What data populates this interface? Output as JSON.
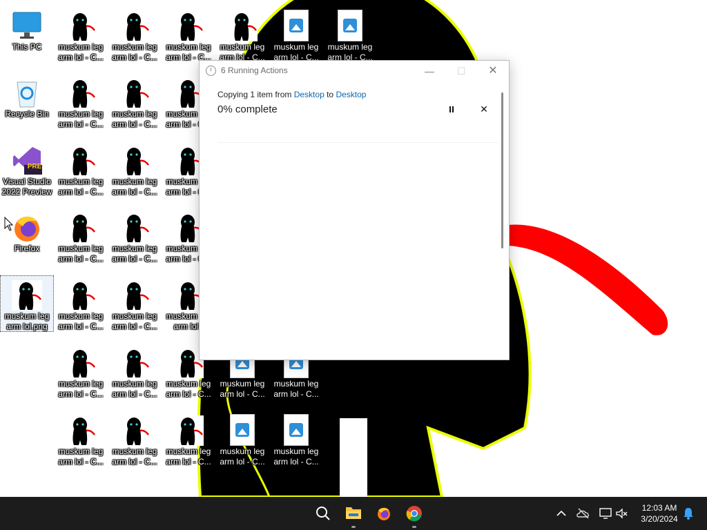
{
  "desktop": {
    "system_icons": [
      {
        "label": "This PC",
        "icon": "monitor-icon"
      },
      {
        "label": "Recycle Bin",
        "icon": "recycle-bin-icon"
      },
      {
        "label": "Visual Studio 2022 Preview",
        "icon": "visual-studio-icon",
        "badge": "PRE"
      },
      {
        "label": "Firefox",
        "icon": "firefox-icon"
      }
    ],
    "file_label_truncated": "muskum leg arm lol - C...",
    "file_label_truncated_short": "muskum leg arm lol - ",
    "file_label_cut": "muskum leg arm lol",
    "file_label_selected": "muskum leg arm lol.png"
  },
  "dialog": {
    "title": "6 Running Actions",
    "copy_prefix": "Copying 1 item from ",
    "source": "Desktop",
    "copy_middle": " to ",
    "destination": "Desktop",
    "progress_text": "0% complete",
    "progress_percent": 0,
    "minimize_glyph": "—",
    "maximize_glyph": "☐",
    "close_glyph": "✕",
    "cancel_glyph": "✕"
  },
  "taskbar": {
    "apps": [
      "search-icon",
      "file-explorer-icon",
      "firefox-icon",
      "chrome-icon"
    ],
    "time": "12:03 AM",
    "date": "3/20/2024",
    "tray_icons": [
      "chevron-up-icon",
      "onedrive-icon",
      "network-icon",
      "volume-muted-icon",
      "notification-bell-icon"
    ]
  },
  "colors": {
    "accent_link": "#0a66b0",
    "taskbar_bg": "#1c1c1c",
    "wallpaper_figure": "#000000",
    "wallpaper_outline": "#f0ff00",
    "wallpaper_arm": "#ff0000"
  }
}
